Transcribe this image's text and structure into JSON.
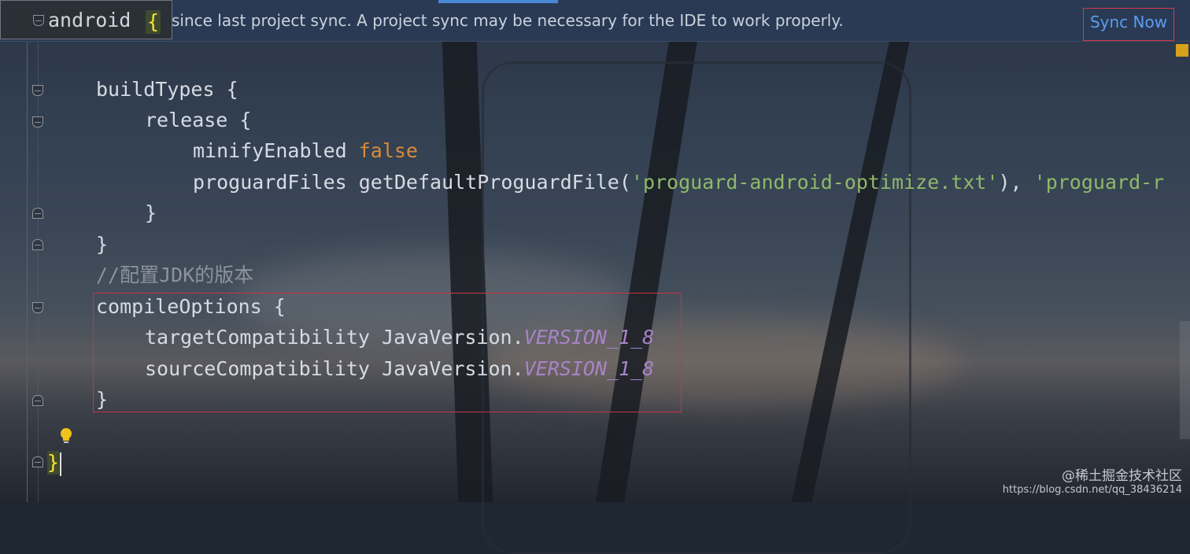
{
  "banner": {
    "message": "since last project sync. A project sync may be necessary for the IDE to work properly.",
    "action_label": "Sync Now"
  },
  "breadcrumb": {
    "label": "android",
    "brace": "{"
  },
  "code": {
    "l1": {
      "a": "buildTypes {"
    },
    "l2": {
      "a": "release {"
    },
    "l3": {
      "a": "minifyEnabled ",
      "kw": "false"
    },
    "l4": {
      "a": "proguardFiles getDefaultProguardFile(",
      "s1": "'proguard-android-optimize.txt'",
      "b": "), ",
      "s2": "'proguard-r"
    },
    "l5": {
      "a": "}"
    },
    "l6": {
      "a": "}"
    },
    "l7": {
      "comment": "//配置JDK的版本"
    },
    "l8": {
      "a": "compileOptions {"
    },
    "l9": {
      "a": "targetCompatibility JavaVersion.",
      "c": "VERSION_1_8"
    },
    "l10": {
      "a": "sourceCompatibility JavaVersion.",
      "c": "VERSION_1_8"
    },
    "l11": {
      "a": "}"
    },
    "l12": {
      "a": "}"
    }
  },
  "watermark": {
    "line1": "@稀土掘金技术社区",
    "line2": "https://blog.csdn.net/qq_38436214"
  },
  "colors": {
    "keyword": "#d98a3a",
    "string": "#8fb86a",
    "constant": "#a784c8",
    "comment": "#8c939c",
    "link": "#5b9cf0",
    "annotation_box": "#c8344a"
  },
  "icons": [
    "fold-icon",
    "lightbulb-icon"
  ]
}
